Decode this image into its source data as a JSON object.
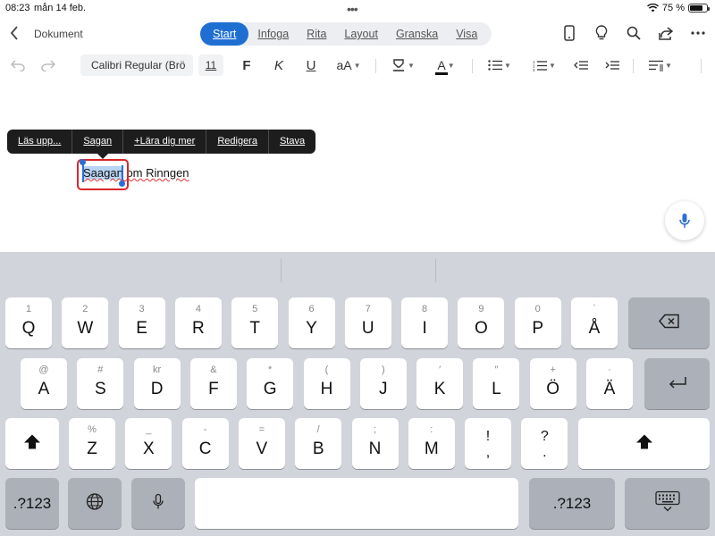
{
  "status": {
    "time": "08:23",
    "date": "mån 14 feb.",
    "battery_text": "75 %",
    "battery_level": 0.75
  },
  "header": {
    "back_label": "Dokument",
    "tabs": [
      {
        "label": "Start",
        "active": true
      },
      {
        "label": "Infoga"
      },
      {
        "label": "Rita"
      },
      {
        "label": "Layout"
      },
      {
        "label": "Granska"
      },
      {
        "label": "Visa"
      }
    ],
    "icons": [
      "phone-icon",
      "lightbulb-icon",
      "search-icon",
      "share-icon",
      "more-icon"
    ]
  },
  "toolbar": {
    "font_name": "Calibri Regular (Brö",
    "font_size": "11",
    "bold": "F",
    "italic": "K",
    "underline": "U",
    "text_size": "aA",
    "font_color": "A"
  },
  "context_menu": [
    "Läs upp...",
    "Sagan",
    "+Lära dig mer",
    "Redigera",
    "Stava"
  ],
  "document": {
    "selected_word": "Saagan",
    "rest": " om Rinngen"
  },
  "keyboard": {
    "row1": [
      {
        "sub": "1",
        "main": "Q"
      },
      {
        "sub": "2",
        "main": "W"
      },
      {
        "sub": "3",
        "main": "E"
      },
      {
        "sub": "4",
        "main": "R"
      },
      {
        "sub": "5",
        "main": "T"
      },
      {
        "sub": "6",
        "main": "Y"
      },
      {
        "sub": "7",
        "main": "U"
      },
      {
        "sub": "8",
        "main": "I"
      },
      {
        "sub": "9",
        "main": "O"
      },
      {
        "sub": "0",
        "main": "P"
      },
      {
        "sub": "`",
        "main": "Å"
      }
    ],
    "row2": [
      {
        "sub": "@",
        "main": "A"
      },
      {
        "sub": "#",
        "main": "S"
      },
      {
        "sub": "kr",
        "main": "D"
      },
      {
        "sub": "&",
        "main": "F"
      },
      {
        "sub": "*",
        "main": "G"
      },
      {
        "sub": "(",
        "main": "H"
      },
      {
        "sub": ")",
        "main": "J"
      },
      {
        "sub": "′",
        "main": "K"
      },
      {
        "sub": "″",
        "main": "L"
      },
      {
        "sub": "+",
        "main": "Ö"
      },
      {
        "sub": "·",
        "main": "Ä"
      }
    ],
    "row3": [
      {
        "sub": "%",
        "main": "Z"
      },
      {
        "sub": "_",
        "main": "X"
      },
      {
        "sub": "-",
        "main": "C"
      },
      {
        "sub": "=",
        "main": "V"
      },
      {
        "sub": "/",
        "main": "B"
      },
      {
        "sub": ";",
        "main": "N"
      },
      {
        "sub": ":",
        "main": "M"
      }
    ],
    "row3_punct": [
      {
        "top": "!",
        "bottom": ","
      },
      {
        "top": "?",
        "bottom": "."
      }
    ],
    "numbers_label": ".?123"
  }
}
